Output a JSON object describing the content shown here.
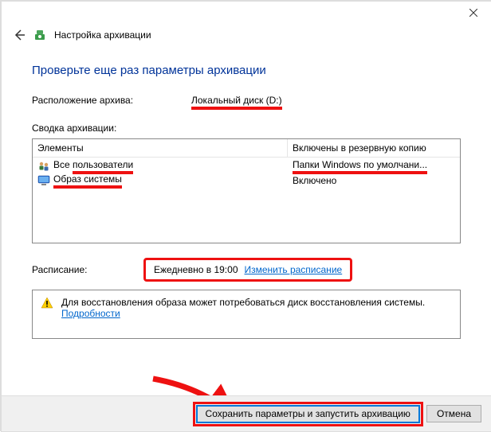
{
  "window": {
    "breadcrumb": "Настройка архивации"
  },
  "title": "Проверьте еще раз параметры архивации",
  "location": {
    "label": "Расположение архива:",
    "value": "Локальный диск (D:)"
  },
  "summary_label": "Сводка архивации:",
  "table": {
    "col_elements": "Элементы",
    "col_included": "Включены в резервную копию",
    "rows": [
      {
        "name": "Все пользователи",
        "inc": "Папки Windows по умолчани..."
      },
      {
        "name": "Образ системы",
        "inc": "Включено"
      }
    ]
  },
  "schedule": {
    "label": "Расписание:",
    "value": "Ежедневно в 19:00",
    "link": "Изменить расписание"
  },
  "info": {
    "text": "Для восстановления образа может потребоваться диск восстановления системы.",
    "link": "Подробности"
  },
  "buttons": {
    "save": "Сохранить параметры и запустить архивацию",
    "cancel": "Отмена"
  }
}
